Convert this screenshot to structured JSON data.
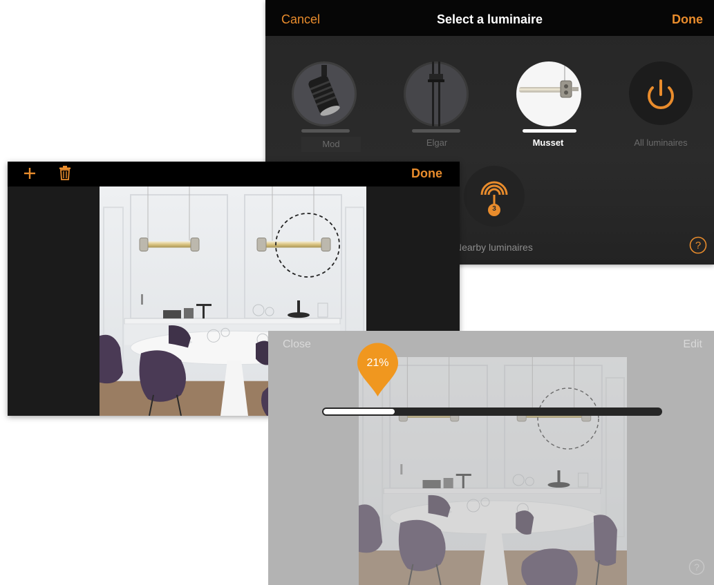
{
  "select_luminaire": {
    "cancel_label": "Cancel",
    "title": "Select a luminaire",
    "done_label": "Done",
    "luminaires": [
      {
        "label": "Mod",
        "selected": false
      },
      {
        "label": "Elgar",
        "selected": false
      },
      {
        "label": "Musset",
        "selected": true
      },
      {
        "label": "All luminaires",
        "selected": false,
        "icon": "power-icon"
      }
    ],
    "nearby": {
      "label": "Nearby luminaires",
      "count": "3",
      "icon": "signal-icon"
    },
    "help_icon": "help-icon"
  },
  "photo_editor": {
    "add_icon": "plus-icon",
    "delete_icon": "trash-icon",
    "done_label": "Done"
  },
  "dimmer": {
    "close_label": "Close",
    "edit_label": "Edit",
    "level_label": "21%",
    "level_fraction": 0.21,
    "help_icon": "help-icon"
  },
  "colors": {
    "accent": "#e98c2c",
    "chair": "#4a3a55",
    "top_bar": "#000000"
  }
}
